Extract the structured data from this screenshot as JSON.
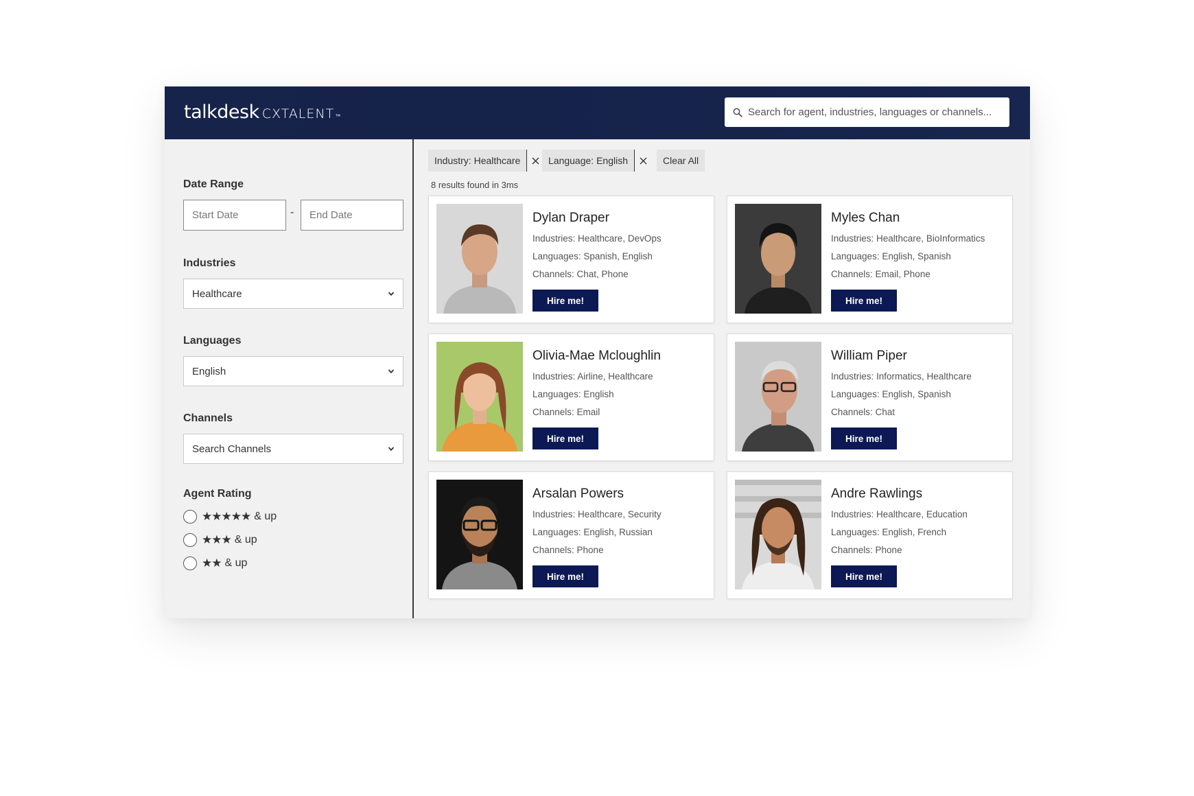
{
  "header": {
    "logo_main": "talkdesk",
    "logo_sub": "CXTALENT",
    "logo_tm": "™",
    "search_placeholder": "Search for agent, industries, languages or channels..."
  },
  "sidebar": {
    "date_range": {
      "title": "Date Range",
      "start_placeholder": "Start Date",
      "end_placeholder": "End Date",
      "separator": "-"
    },
    "industries": {
      "title": "Industries",
      "selected": "Healthcare"
    },
    "languages": {
      "title": "Languages",
      "selected": "English"
    },
    "channels": {
      "title": "Channels",
      "selected": "Search Channels"
    },
    "rating": {
      "title": "Agent Rating",
      "options": [
        {
          "stars": "★★★★★",
          "label": "& up"
        },
        {
          "stars": "★★★",
          "label": "& up"
        },
        {
          "stars": "★★",
          "label": "& up"
        }
      ]
    }
  },
  "filters": {
    "chips": [
      "Industry: Healthcare",
      "Language: English"
    ],
    "clear_all": "Clear All",
    "results_text": "8 results found in 3ms"
  },
  "agents": [
    {
      "name": "Dylan Draper",
      "industries": "Industries: Healthcare, DevOps",
      "languages": "Languages: Spanish, English",
      "channels": "Channels: Chat, Phone",
      "button": "Hire me!"
    },
    {
      "name": "Myles Chan",
      "industries": "Industries: Healthcare, BioInformatics",
      "languages": "Languages: English, Spanish",
      "channels": "Channels: Email, Phone",
      "button": "Hire me!"
    },
    {
      "name": "Olivia-Mae Mcloughlin",
      "industries": "Industries: Airline, Healthcare",
      "languages": "Languages: English",
      "channels": "Channels: Email",
      "button": "Hire me!"
    },
    {
      "name": "William Piper",
      "industries": "Industries: Informatics, Healthcare",
      "languages": "Languages: English, Spanish",
      "channels": "Channels: Chat",
      "button": "Hire me!"
    },
    {
      "name": "Arsalan Powers",
      "industries": "Industries: Healthcare, Security",
      "languages": "Languages: English, Russian",
      "channels": "Channels: Phone",
      "button": "Hire me!"
    },
    {
      "name": "Andre Rawlings",
      "industries": "Industries: Healthcare, Education",
      "languages": "Languages: English, French",
      "channels": "Channels: Phone",
      "button": "Hire me!"
    }
  ],
  "colors": {
    "header_bg": "#16234a",
    "button_bg": "#0d1954",
    "panel_bg": "#f1f1f1"
  },
  "icons": {
    "search": "search-icon",
    "chip_close": "close-icon",
    "select": "chevron-down-icon"
  }
}
